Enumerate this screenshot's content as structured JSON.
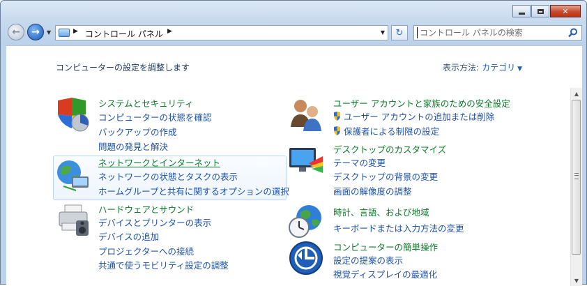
{
  "window": {
    "minimize_icon": "minimize-icon",
    "maximize_icon": "maximize-icon",
    "close_icon": "close-icon"
  },
  "nav": {
    "back_glyph": "←",
    "forward_glyph": "→",
    "breadcrumb": "コントロール パネル",
    "refresh_glyph": "↻",
    "search_placeholder": "コントロール パネルの検索"
  },
  "header": {
    "title": "コンピューターの設定を調整します",
    "view_by_label": "表示方法:",
    "view_by_value": "カテゴリ"
  },
  "categories": [
    {
      "title": "システムとセキュリティ",
      "icon": "shield-icon",
      "links": [
        "コンピューターの状態を確認",
        "バックアップの作成",
        "問題の発見と解決"
      ]
    },
    {
      "title": "ネットワークとインターネット",
      "icon": "network-icon",
      "links": [
        "ネットワークの状態とタスクの表示",
        "ホームグループと共有に関するオプションの選択"
      ]
    },
    {
      "title": "ハードウェアとサウンド",
      "icon": "printer-icon",
      "links": [
        "デバイスとプリンターの表示",
        "デバイスの追加",
        "プロジェクターへの接続",
        "共通で使うモビリティ設定の調整"
      ]
    },
    {
      "title": "ユーザー アカウントと家族のための安全設定",
      "icon": "users-icon",
      "links": [
        "ユーザー アカウントの追加または削除",
        "保護者による制限の設定"
      ]
    },
    {
      "title": "デスクトップのカスタマイズ",
      "icon": "desktop-icon",
      "links": [
        "テーマの変更",
        "デスクトップの背景の変更",
        "画面の解像度の調整"
      ]
    },
    {
      "title": "時計、言語、および地域",
      "icon": "clock-globe-icon",
      "links": [
        "キーボードまたは入力方法の変更"
      ]
    },
    {
      "title": "コンピューターの簡単操作",
      "icon": "ease-of-access-icon",
      "links": [
        "設定の提案の表示",
        "視覚ディスプレイの最適化"
      ]
    }
  ],
  "colors": {
    "title_green": "#0b7a27",
    "link_blue": "#1e52a7",
    "heading": "#1e395b"
  }
}
